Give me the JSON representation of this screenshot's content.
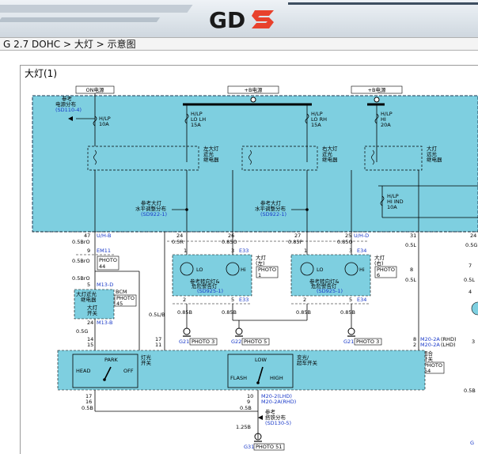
{
  "header": {
    "logo_text": "GDS",
    "logo_colors": {
      "letters": "#1a1a1a",
      "accent": "#e8412c"
    }
  },
  "breadcrumb": {
    "items": [
      "G 2.7 DOHC",
      "大灯",
      "示意图"
    ],
    "separator": ">"
  },
  "panel": {
    "title": "大灯(1)"
  },
  "diagram": {
    "power_labels": [
      "ON电源",
      "+B电源",
      "+B电源"
    ],
    "ref_top": {
      "line1": "参考",
      "line2": "电源分布",
      "code": "(SD110-4)"
    },
    "fuses": [
      {
        "l1": "H/LP",
        "l2": "10A"
      },
      {
        "l1": "H/LP",
        "l2": "LO LH",
        "l3": "15A"
      },
      {
        "l1": "H/LP",
        "l2": "LO RH",
        "l3": "15A"
      },
      {
        "l1": "H/LP",
        "l2": "HI",
        "l3": "20A"
      },
      {
        "l1": "H/LP",
        "l2": "HI IND",
        "l3": "10A"
      }
    ],
    "relays": [
      {
        "l1": "左大灯",
        "l2": "近光",
        "l3": "继电器"
      },
      {
        "l1": "右大灯",
        "l2": "近光",
        "l3": "继电器"
      },
      {
        "l1": "大灯",
        "l2": "远光",
        "l3": "继电器"
      }
    ],
    "ref_level": [
      {
        "l1": "参考大灯",
        "l2": "水平调整分布",
        "code": "(SD922-1)"
      },
      {
        "l1": "参考大灯",
        "l2": "水平调整分布",
        "code": "(SD922-1)"
      }
    ],
    "conn_row1": [
      {
        "pin": "47",
        "wire": "0.5BrO",
        "conn": "U/H-B"
      },
      {
        "pin": "24",
        "wire": "0.5R",
        "conn": ""
      },
      {
        "pin": "26",
        "wire": "0.85O",
        "conn": ""
      },
      {
        "pin": "27",
        "wire": "0.85P",
        "conn": ""
      },
      {
        "pin": "25",
        "wire": "0.85O",
        "conn": "U/H-D"
      },
      {
        "pin": "31",
        "wire": "0.5L",
        "conn": ""
      },
      {
        "pin": "24",
        "wire": "0.5G",
        "conn": ""
      }
    ],
    "em11": {
      "pin": "9",
      "conn": "EM11",
      "wire": "0.5BrO",
      "photo": "PHOTO",
      "photo_no": "44"
    },
    "lamp_left": {
      "pin1": "1",
      "pin3": "3",
      "conn": "E33",
      "title1": "大灯",
      "title2": "(左)",
      "photo": "PHOTO",
      "photo_no": "1",
      "lo": "LO",
      "hi": "Hi",
      "ref1": "参考转向灯&",
      "ref2": "危险警告灯",
      "code": "(SD925-1)",
      "pin2": "2",
      "pin5": "5",
      "conn2": "E33",
      "wire1": "0.85B",
      "wire2": "0.85B"
    },
    "lamp_right": {
      "pin1": "1",
      "pin3": "3",
      "conn": "E34",
      "title1": "大灯",
      "title2": "(右)",
      "photo": "PHOTO",
      "photo_no": "6",
      "lo": "LO",
      "hi": "Hi",
      "ref1": "参考转向灯&",
      "ref2": "危险警告灯",
      "code": "(SD925-1)",
      "pin2": "2",
      "pin5": "5",
      "conn2": "E34",
      "wire1": "0.85B",
      "wire2": "0.85B"
    },
    "m13d": {
      "wire": "0.5BrO",
      "pin": "5",
      "conn": "M13-D"
    },
    "bcm": {
      "title": "BCM",
      "photo": "PHOTO",
      "photo_no": "45",
      "l1": "大灯近光",
      "l2": "继电器",
      "l3": "大灯",
      "l4": "开关"
    },
    "m13b": {
      "pin": "24",
      "conn": "M13-B",
      "wire": "0.5G",
      "pin2": "14",
      "pin3": "15"
    },
    "wire_05lb": "0.5L/B",
    "pins_mid": [
      "17",
      "11"
    ],
    "grounds": [
      {
        "code": "G21",
        "photo": "PHOTO 3"
      },
      {
        "code": "G22",
        "photo": "PHOTO 5"
      },
      {
        "code": "G21",
        "photo": "PHOTO 3"
      },
      {
        "code": "G31",
        "photo": "PHOTO 51"
      }
    ],
    "right_col": {
      "pin": "8",
      "wire": "0.5L",
      "pin_b": "2",
      "conn1": "M20-2A",
      "conn1_side": "(RHD)",
      "conn2": "M20-2A",
      "conn2_side": "(LHD)",
      "pin_c": "8",
      "wire2": "0.5L",
      "pin_d": "3",
      "wire3": "0.5B",
      "title1": "组合",
      "title2": "开关",
      "photo": "PHOTO",
      "photo_no": "54",
      "num": "3"
    },
    "switch": {
      "lamp_sw1": "灯光",
      "lamp_sw2": "开关",
      "head": "HEAD",
      "park": "PARK",
      "off": "OFF",
      "pass_sw1": "变光/",
      "pass_sw2": "超车开关",
      "low": "LOW",
      "high": "HIGH",
      "flash": "FLASH"
    },
    "bottom": {
      "pins_left": [
        "17",
        "16"
      ],
      "wire_left": "0.5B",
      "pins_right": [
        "10",
        "9"
      ],
      "conn_a": "M20-2(LHD)",
      "conn_b": "M20-2A(RHD)",
      "wire_right": "0.5B",
      "ref1": "参考",
      "ref2": "搭铁分布",
      "code": "(SD130-5)",
      "wire_g": "1.25B"
    },
    "right_edge": [
      "24",
      "0.5G",
      "7",
      "0.5L",
      "4",
      "3",
      "0.5B",
      "G"
    ]
  }
}
